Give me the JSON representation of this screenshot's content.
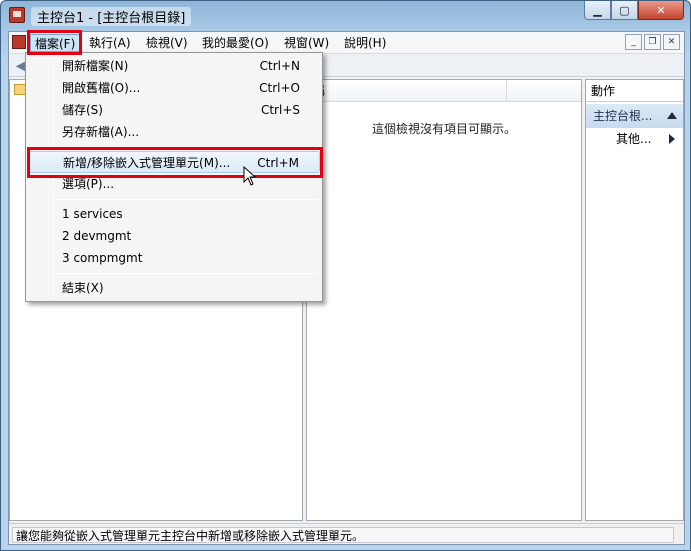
{
  "window": {
    "title": "主控台1 - [主控台根目錄]"
  },
  "menubar": {
    "items": [
      "檔案(F)",
      "執行(A)",
      "檢視(V)",
      "我的最愛(O)",
      "視窗(W)",
      "說明(H)"
    ],
    "active": "檔案(F)"
  },
  "file_menu": {
    "items": [
      {
        "label": "開新檔案(N)",
        "shortcut": "Ctrl+N"
      },
      {
        "label": "開啟舊檔(O)...",
        "shortcut": "Ctrl+O"
      },
      {
        "label": "儲存(S)",
        "shortcut": "Ctrl+S"
      },
      {
        "label": "另存新檔(A)...",
        "shortcut": ""
      },
      {
        "label": "新增/移除嵌入式管理單元(M)...",
        "shortcut": "Ctrl+M"
      },
      {
        "label": "選項(P)...",
        "shortcut": ""
      },
      {
        "label": "1 services",
        "shortcut": ""
      },
      {
        "label": "2 devmgmt",
        "shortcut": ""
      },
      {
        "label": "3 compmgmt",
        "shortcut": ""
      },
      {
        "label": "結束(X)",
        "shortcut": ""
      }
    ]
  },
  "list_pane": {
    "column_header": "稱",
    "empty_message": "這個檢視沒有項目可顯示。"
  },
  "actions_pane": {
    "header": "動作",
    "group": "主控台根...",
    "item": "其他..."
  },
  "statusbar": {
    "text": "讓您能夠從嵌入式管理單元主控台中新增或移除嵌入式管理單元。"
  },
  "colors": {
    "highlight": "#e0000f"
  }
}
